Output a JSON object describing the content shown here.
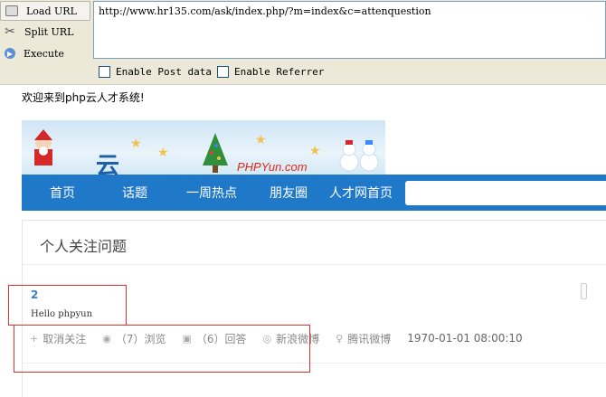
{
  "hackbar": {
    "load_label": "Load URL",
    "split_label": "Split URL",
    "execute_label": "Execute",
    "url": "http://www.hr135.com/ask/index.php/?m=index&c=attenquestion",
    "enable_post": "Enable Post data",
    "enable_referrer": "Enable Referrer"
  },
  "page": {
    "welcome": "欢迎来到php云人才系统!",
    "banner_logo": "PHPYun.com",
    "nav": [
      "首页",
      "话题",
      "一周热点",
      "朋友圈",
      "人才网首页"
    ],
    "panel_title": "个人关注问题"
  },
  "question": {
    "number": "2",
    "author": "Hello phpyun",
    "unfollow": "取消关注",
    "views": "（7）浏览",
    "answers": "（6）回答",
    "sina": "新浪微博",
    "tencent": "腾讯微博",
    "date": "1970-01-01 08:00:10"
  },
  "colors": {
    "nav_bg": "#1f78c8",
    "highlight_box": "#e03030",
    "accent_link": "#3a7fc2"
  }
}
